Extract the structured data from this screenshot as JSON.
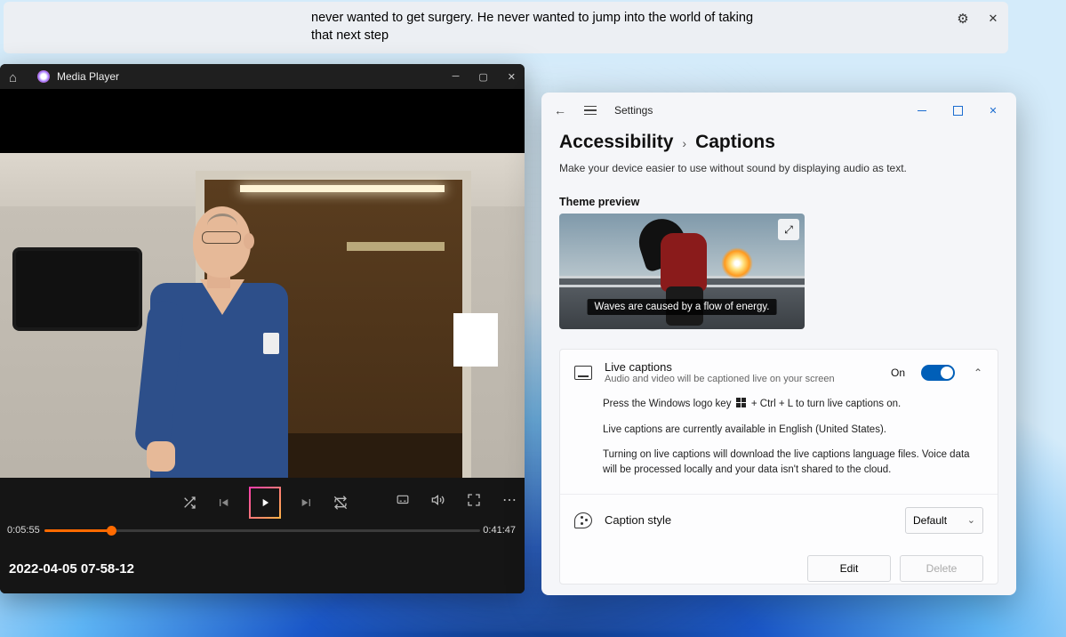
{
  "live_caption_bar": {
    "text": "never wanted to get surgery. He never wanted to jump into the world of taking that next step"
  },
  "media_player": {
    "app_name": "Media Player",
    "time_elapsed": "0:05:55",
    "time_total": "0:41:47",
    "file_title": "2022-04-05 07-58-12"
  },
  "settings": {
    "window_title": "Settings",
    "breadcrumb_parent": "Accessibility",
    "breadcrumb_current": "Captions",
    "subtitle": "Make your device easier to use without sound by displaying audio as text.",
    "theme_preview_label": "Theme preview",
    "preview_caption": "Waves are caused by a flow of energy.",
    "live_captions": {
      "title": "Live captions",
      "subtitle": "Audio and video will be captioned live on your screen",
      "state_label": "On",
      "hint_prefix": "Press the Windows logo key ",
      "hint_suffix": " + Ctrl + L to turn live captions on.",
      "lang_note": "Live captions are currently available in English (United States).",
      "privacy_note": "Turning on live captions will download the live captions language files. Voice data will be processed locally and your data isn't shared to the cloud."
    },
    "caption_style": {
      "title": "Caption style",
      "selected": "Default",
      "edit_label": "Edit",
      "delete_label": "Delete"
    }
  }
}
